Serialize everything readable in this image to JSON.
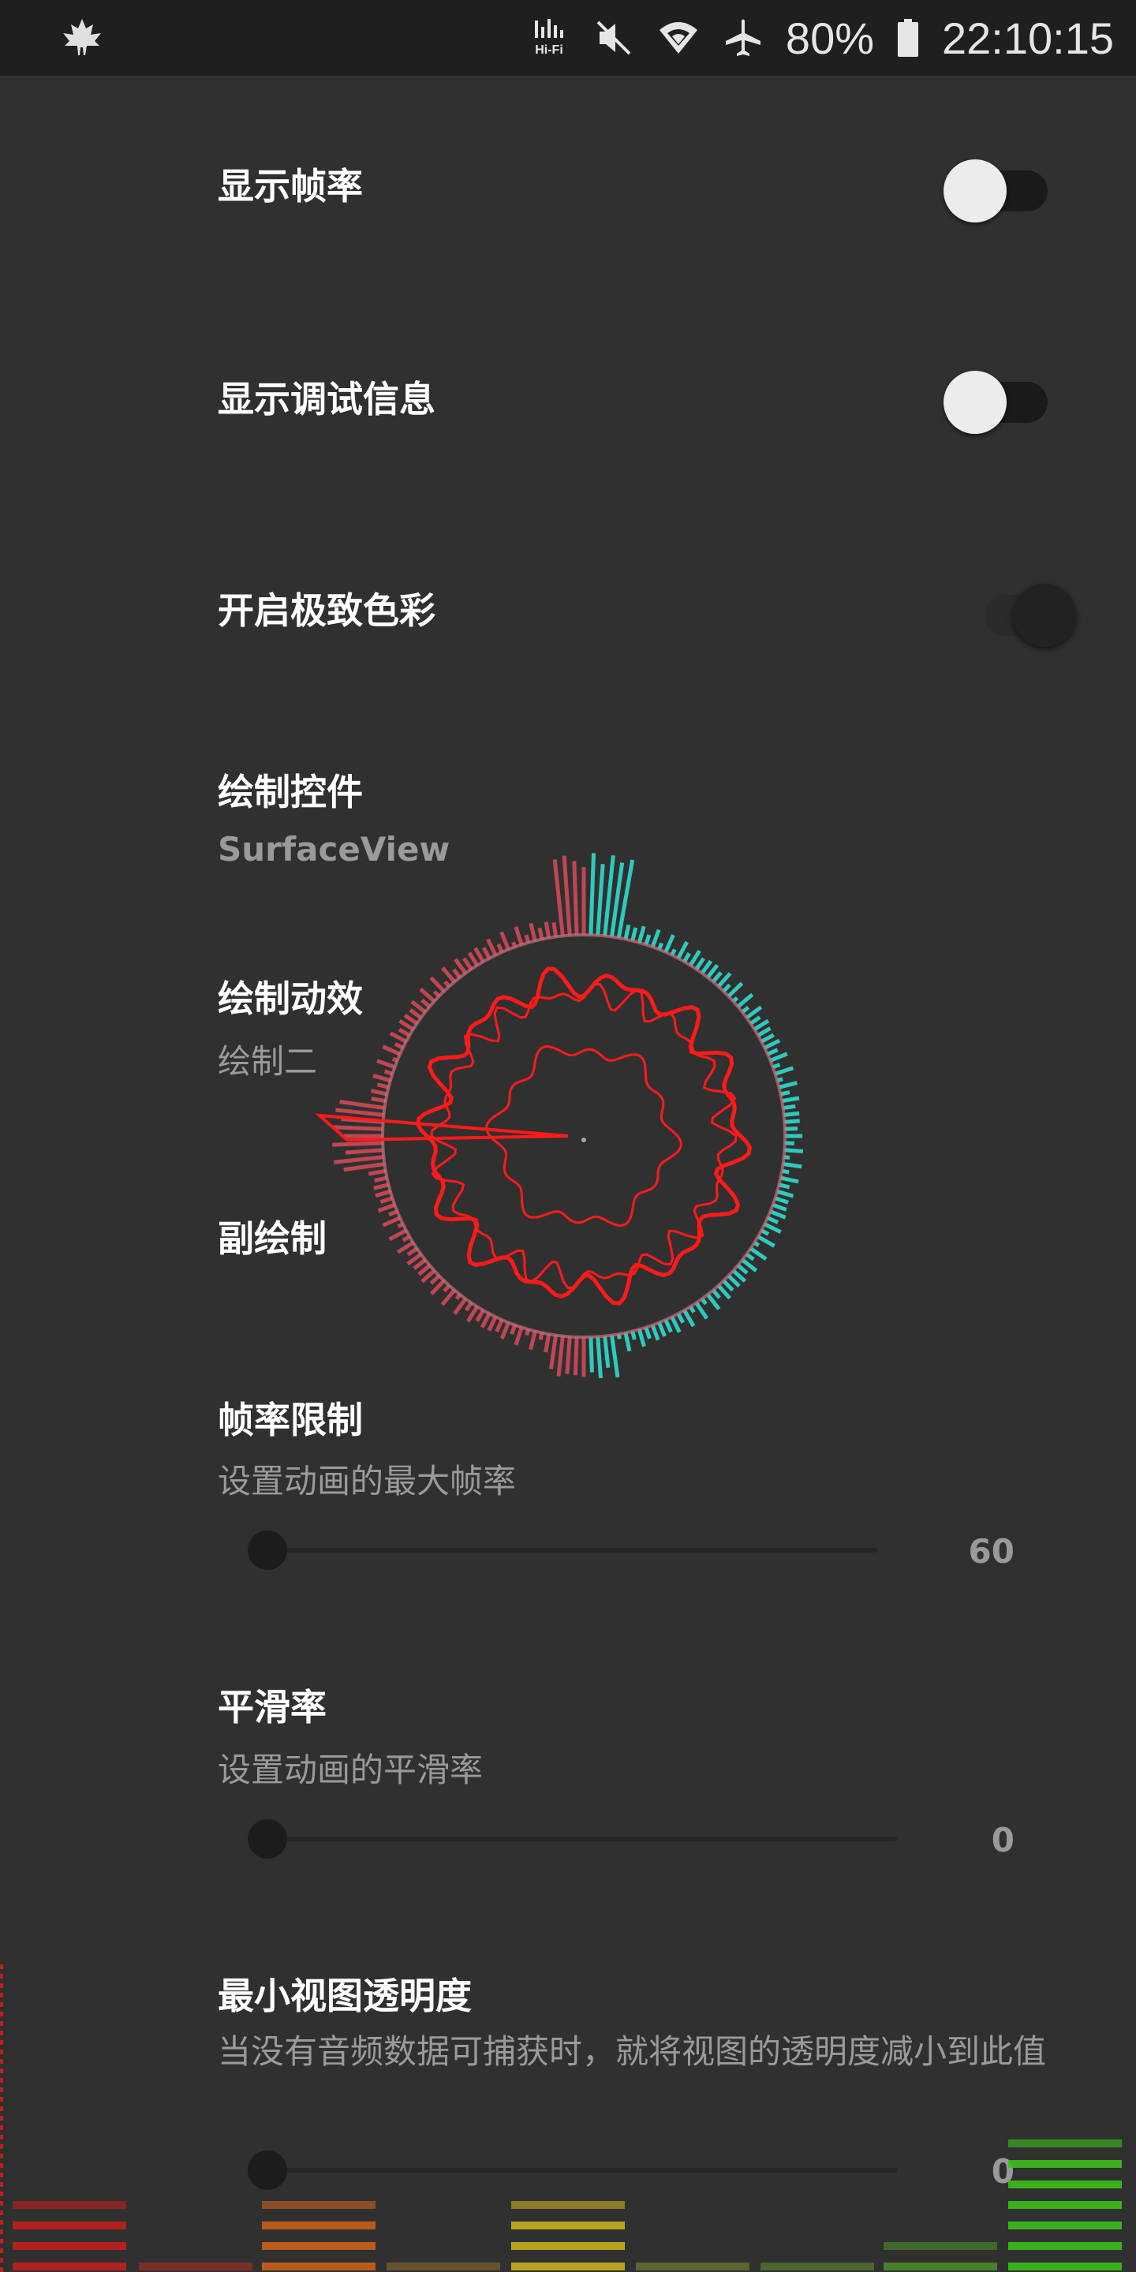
{
  "status_bar": {
    "app_icon": "maple-leaf-icon",
    "icons": [
      "hifi-icon",
      "mute-icon",
      "wifi-icon",
      "airplane-icon"
    ],
    "hifi_label": "Hi-Fi",
    "battery_percent": "80%",
    "time": "22:10:15"
  },
  "settings": {
    "show_fps": {
      "title": "显示帧率",
      "enabled": false
    },
    "show_debug": {
      "title": "显示调试信息",
      "enabled": false
    },
    "extreme_color": {
      "title": "开启极致色彩",
      "enabled": true
    },
    "draw_widget": {
      "title": "绘制控件",
      "value": "SurfaceView"
    },
    "draw_effect": {
      "title": "绘制动效",
      "value": "绘制二"
    },
    "sub_draw": {
      "title": "副绘制"
    },
    "fps_limit": {
      "title": "帧率限制",
      "summary": "设置动画的最大帧率",
      "value": "60"
    },
    "smoothing": {
      "title": "平滑率",
      "summary": "设置动画的平滑率",
      "value": "0"
    },
    "min_alpha": {
      "title": "最小视图透明度",
      "summary": "当没有音频数据可捕获时，就将视图的透明度减小到此值",
      "value": "0"
    }
  },
  "colors": {
    "background": "#303030",
    "statusbar": "#1f1f1f",
    "viz_red": "#ff1a1a",
    "viz_cyan": "#2ee6d6"
  }
}
